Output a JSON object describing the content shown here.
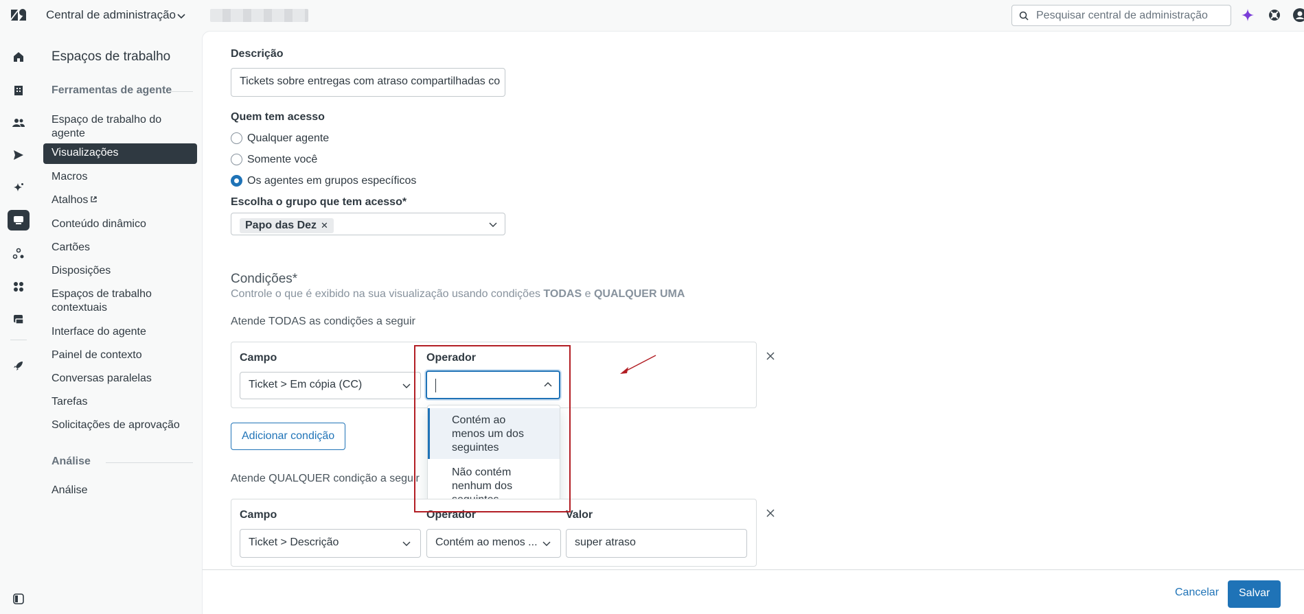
{
  "topbar": {
    "app_title": "Central de administração",
    "search_placeholder": "Pesquisar central de administração"
  },
  "sidebar": {
    "title": "Espaços de trabalho",
    "section_agent_tools": "Ferramentas de agente",
    "items": [
      "Espaço de trabalho do agente",
      "Visualizações",
      "Macros",
      "Atalhos",
      "Conteúdo dinâmico",
      "Cartões",
      "Disposições",
      "Espaços de trabalho contextuais",
      "Interface do agente",
      "Painel de contexto",
      "Conversas paralelas",
      "Tarefas",
      "Solicitações de aprovação"
    ],
    "section_analysis": "Análise",
    "analysis_items": [
      "Análise"
    ]
  },
  "form": {
    "description_label": "Descrição",
    "description_value": "Tickets sobre entregas com atraso compartilhadas co",
    "access_label": "Quem tem acesso",
    "access_options": [
      "Qualquer agente",
      "Somente você",
      "Os agentes em grupos específicos"
    ],
    "access_selected": "Os agentes em grupos específicos",
    "group_label": "Escolha o grupo que tem acesso*",
    "group_tag": "Papo das Dez",
    "conditions_title": "Condições*",
    "conditions_help_prefix": "Controle o que é exibido na sua visualização usando condições ",
    "conditions_help_all": "TODAS",
    "conditions_help_and": " e ",
    "conditions_help_any": "QUALQUER UMA",
    "all_heading": "Atende TODAS as condições a seguir",
    "any_heading": "Atende QUALQUER condição a seguir",
    "field_label": "Campo",
    "operator_label": "Operador",
    "value_label": "Valor",
    "all_condition": {
      "field": "Ticket > Em cópia (CC)",
      "operator": ""
    },
    "operator_options": [
      "Contém ao menos um dos seguintes",
      "Não contém nenhum dos seguintes"
    ],
    "add_condition": "Adicionar condição",
    "any_condition": {
      "field": "Ticket > Descrição",
      "operator": "Contém ao menos ...",
      "value": "super atraso"
    }
  },
  "footer": {
    "cancel": "Cancelar",
    "save": "Salvar"
  },
  "colors": {
    "accent": "#1f73b7",
    "highlight_border": "#b21d23",
    "sidebar_active": "#2f3941",
    "ai_icon": "#7a3dd8"
  }
}
